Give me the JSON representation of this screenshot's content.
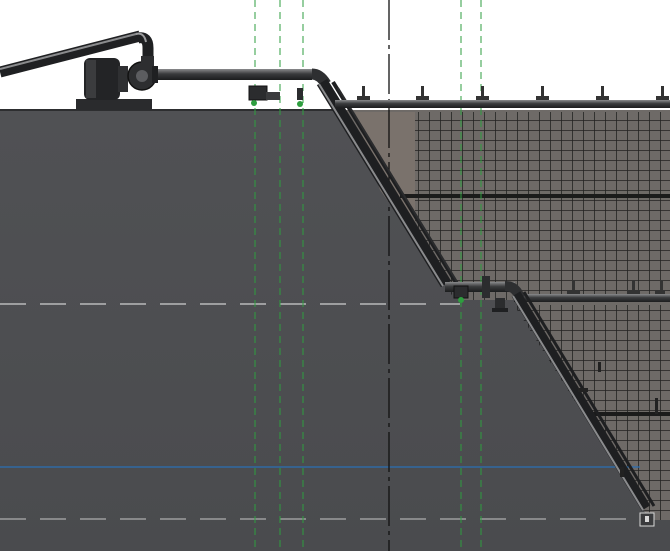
{
  "view": {
    "type": "pump pipeline section elevation",
    "background_color": "#ffffff"
  },
  "colors": {
    "ground": "#4c4d50",
    "ground_dark": "#3f4043",
    "slope_cut": "#6f6a66",
    "grid_line": "#1a1a1a",
    "pipe": "#2e2f31",
    "pipe_highlight": "#8a8b8d",
    "support": "#3a3b3d",
    "pump_body": "#2b2c2e",
    "green_dashed": "#2e9e3f",
    "black_dashed": "#111111",
    "blue_line": "#2a6fb5",
    "white_dashed": "#c9c9c9"
  },
  "icons": {
    "pump": "pump-icon",
    "valve": "valve-icon",
    "support": "pipe-support-icon",
    "flange": "flange-icon"
  },
  "elements": {
    "pump_count": 1,
    "upper_bench_supports": 6,
    "lower_bench_supports": 3,
    "valve_count": 2
  }
}
